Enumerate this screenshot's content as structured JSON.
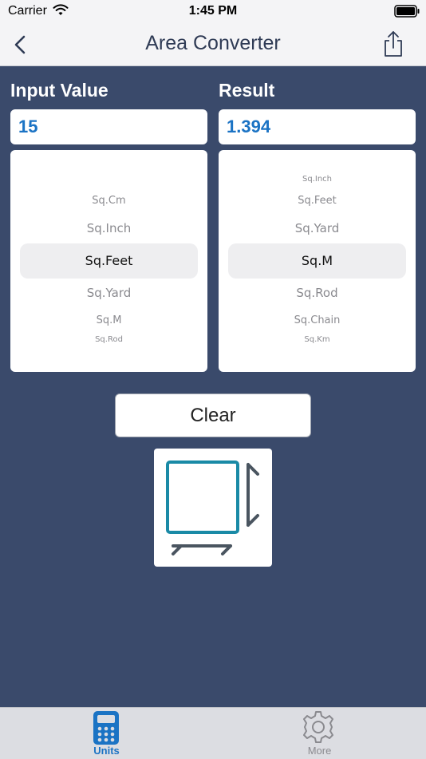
{
  "status_bar": {
    "carrier": "Carrier",
    "time": "1:45 PM"
  },
  "nav": {
    "title": "Area Converter",
    "back_icon": "chevron-left-icon",
    "share_icon": "share-icon"
  },
  "input": {
    "label": "Input Value",
    "value": "15"
  },
  "result": {
    "label": "Result",
    "value": "1.394"
  },
  "input_picker": {
    "items": [
      "Sq.Cm",
      "Sq.Inch",
      "Sq.Feet",
      "Sq.Yard",
      "Sq.M",
      "Sq.Rod"
    ],
    "selected": "Sq.Feet"
  },
  "result_picker": {
    "items": [
      "Sq.Inch",
      "Sq.Feet",
      "Sq.Yard",
      "Sq.M",
      "Sq.Rod",
      "Sq.Chain",
      "Sq.Km"
    ],
    "selected": "Sq.M"
  },
  "clear_button": {
    "label": "Clear"
  },
  "tabs": [
    {
      "label": "Units",
      "icon": "calculator-icon",
      "active": true
    },
    {
      "label": "More",
      "icon": "gear-icon",
      "active": false
    }
  ],
  "colors": {
    "background": "#3a4a6b",
    "accent": "#1b73c4",
    "icon_teal": "#1a8aa6",
    "icon_gray": "#4a5560",
    "tab_inactive": "#8a8a8f"
  }
}
